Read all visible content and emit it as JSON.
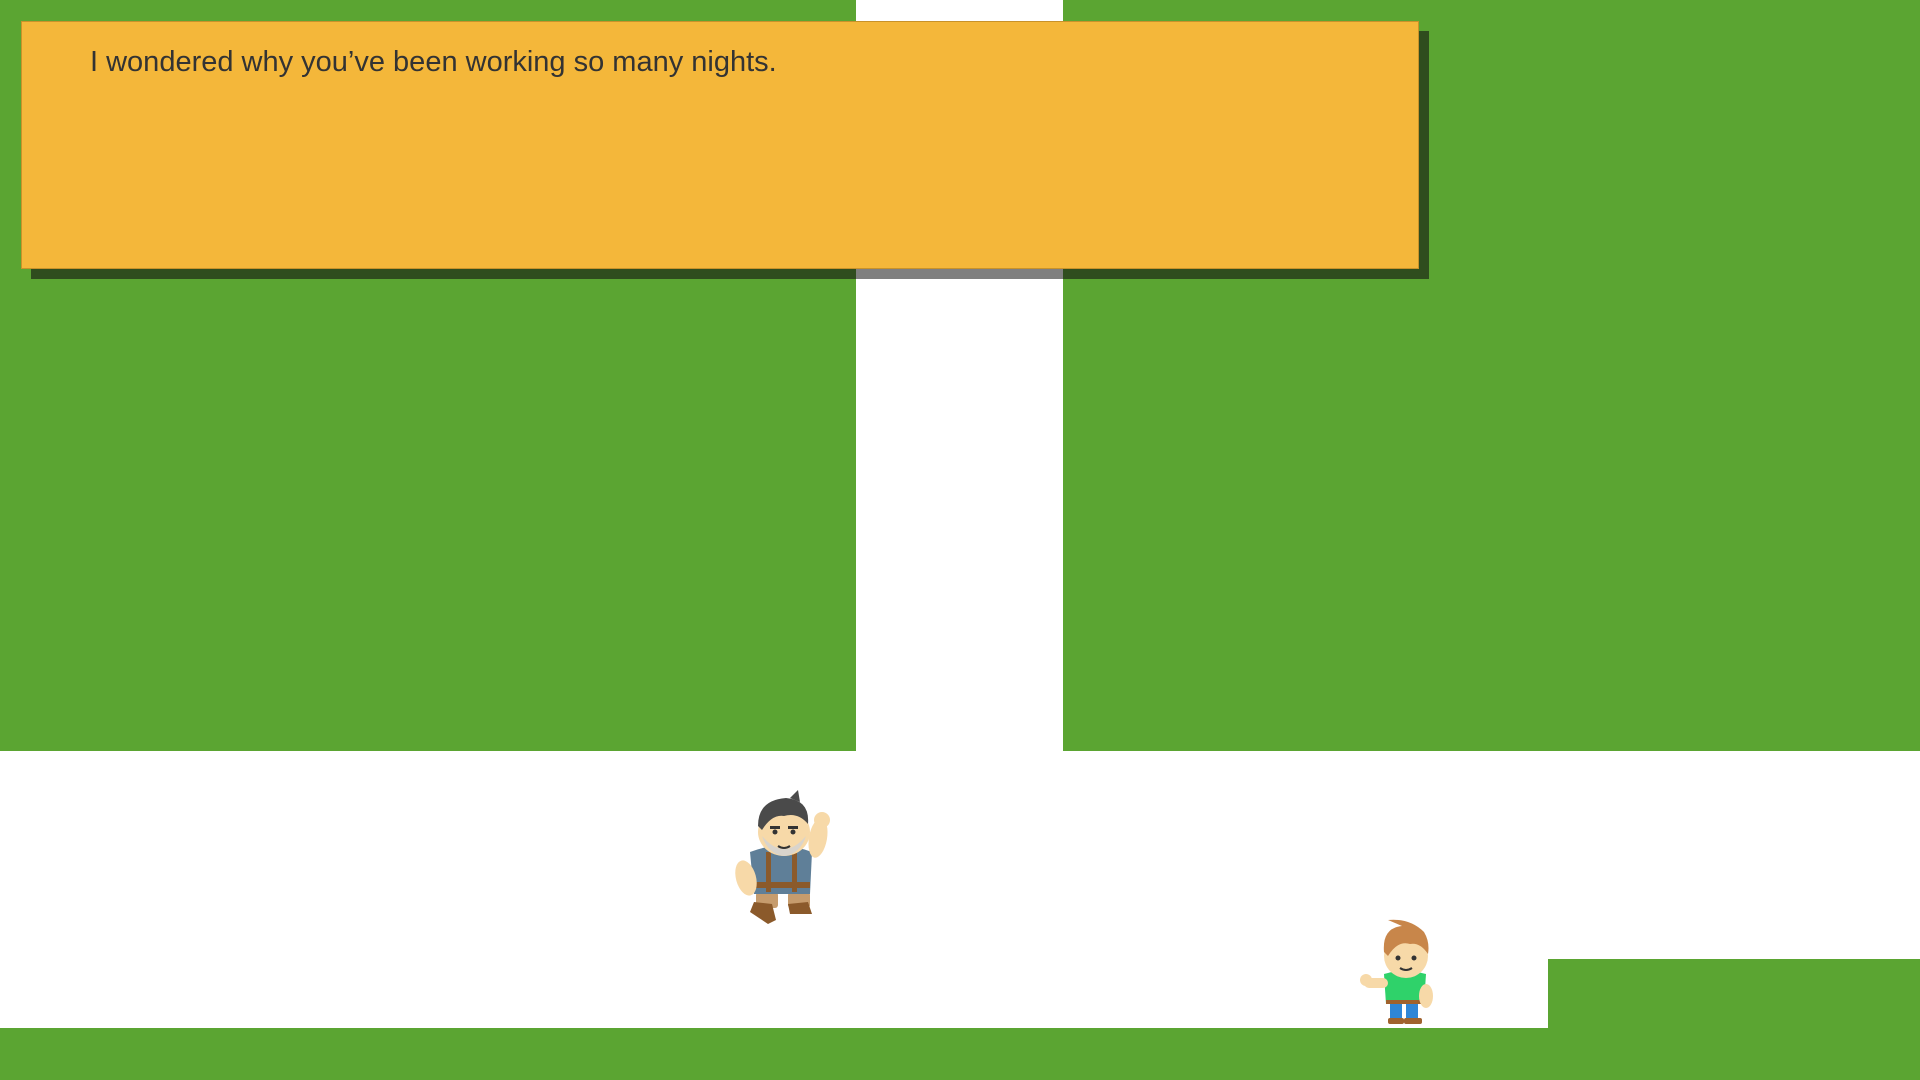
{
  "dialog": {
    "text": "I wondered why you’ve been working so many nights."
  },
  "colors": {
    "grass": "#5ba532",
    "path": "#ffffff",
    "dialog_bg": "#f4b73a",
    "dialog_shadow": "#2f4d1e",
    "text": "#333333"
  },
  "characters": [
    {
      "name": "bearded-man",
      "icon": "bearded-man-sprite",
      "pose": "waving"
    },
    {
      "name": "boy",
      "icon": "boy-sprite",
      "pose": "pointing"
    }
  ]
}
